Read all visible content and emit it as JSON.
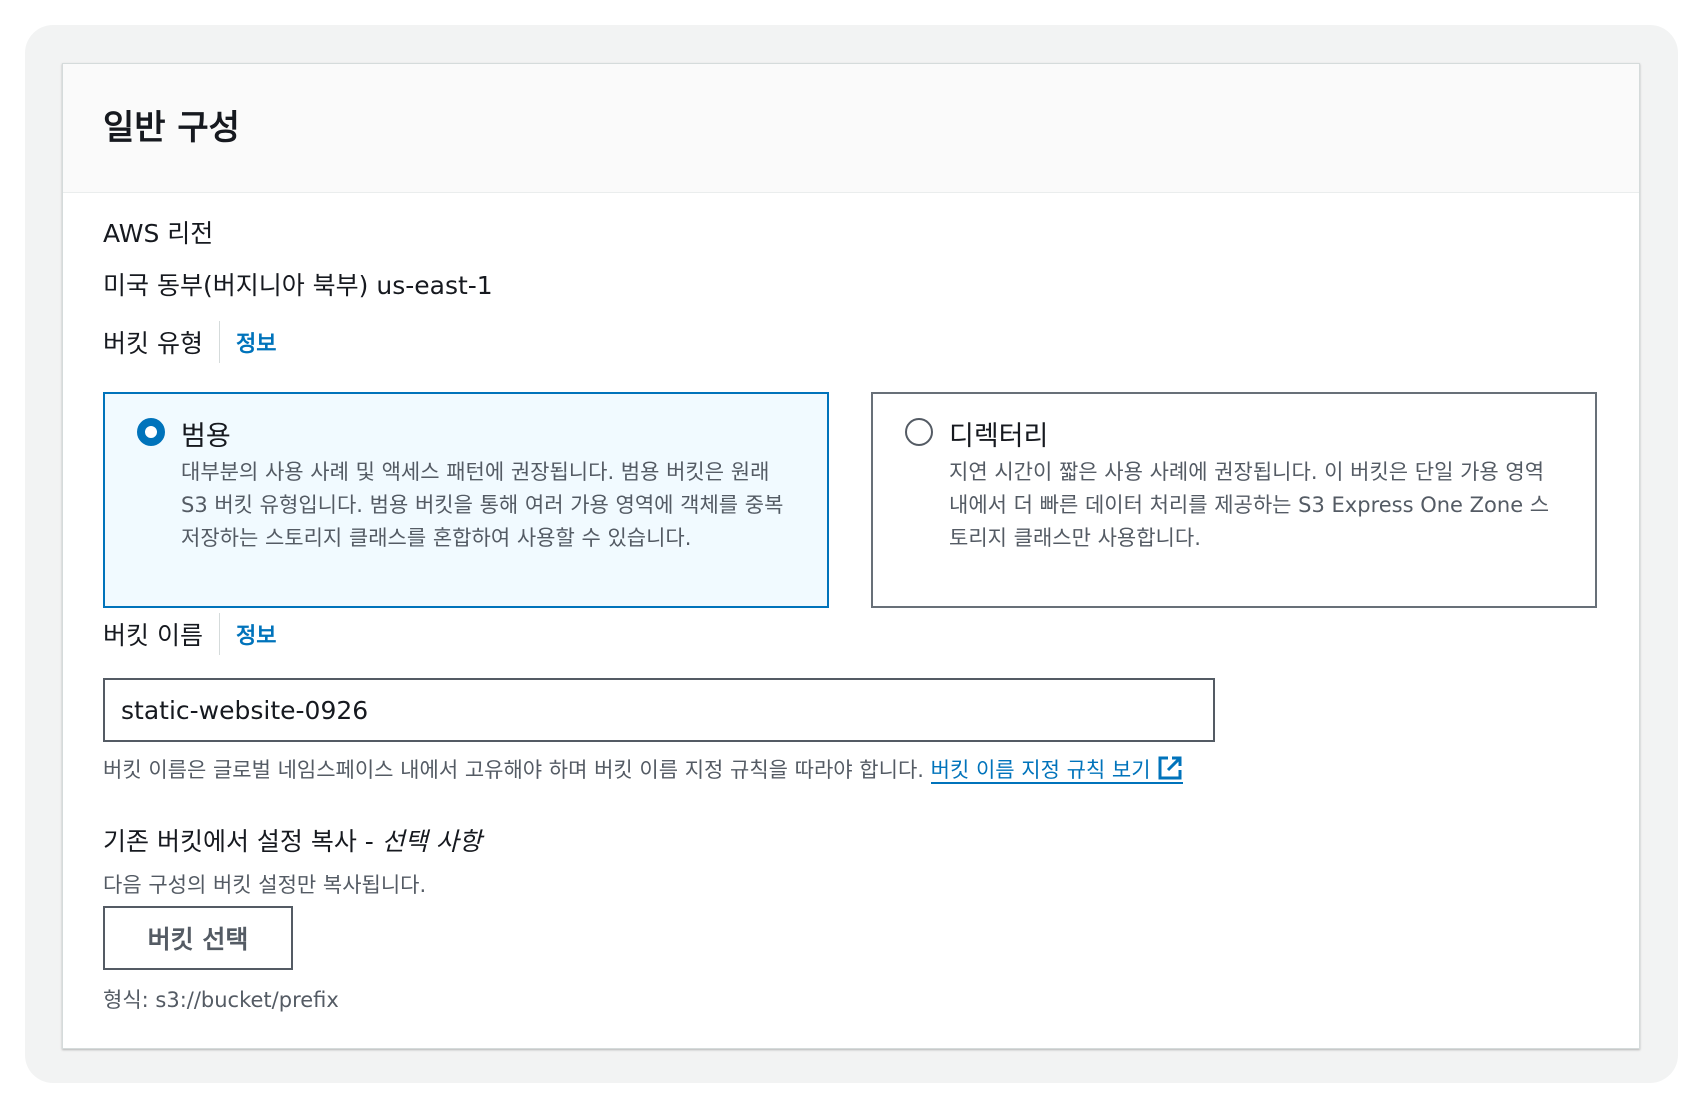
{
  "panel": {
    "title": "일반 구성"
  },
  "region": {
    "label": "AWS 리전",
    "value": "미국 동부(버지니아 북부) us-east-1"
  },
  "bucket_type": {
    "label": "버킷 유형",
    "info_link": "정보",
    "options": [
      {
        "title": "범용",
        "description": "대부분의 사용 사례 및 액세스 패턴에 권장됩니다. 범용 버킷은 원래 S3 버킷 유형입니다. 범용 버킷을 통해 여러 가용 영역에 객체를 중복 저장하는 스토리지 클래스를 혼합하여 사용할 수 있습니다.",
        "selected": true
      },
      {
        "title": "디렉터리",
        "description": "지연 시간이 짧은 사용 사례에 권장됩니다. 이 버킷은 단일 가용 영역 내에서 더 빠른 데이터 처리를 제공하는 S3 Express One Zone 스토리지 클래스만 사용합니다.",
        "selected": false
      }
    ]
  },
  "bucket_name": {
    "label": "버킷 이름",
    "info_link": "정보",
    "value": "static-website-0926",
    "hint": "버킷 이름은 글로벌 네임스페이스 내에서 고유해야 하며 버킷 이름 지정 규칙을 따라야 합니다.",
    "rules_link": "버킷 이름 지정 규칙 보기"
  },
  "copy_settings": {
    "label": "기존 버킷에서 설정 복사 -",
    "optional": "선택 사항",
    "description": "다음 구성의 버킷 설정만 복사됩니다.",
    "button_label": "버킷 선택",
    "format_hint": "형식: s3://bucket/prefix"
  },
  "colors": {
    "accent": "#0073bb",
    "selected_tile_bg": "#f1faff"
  }
}
